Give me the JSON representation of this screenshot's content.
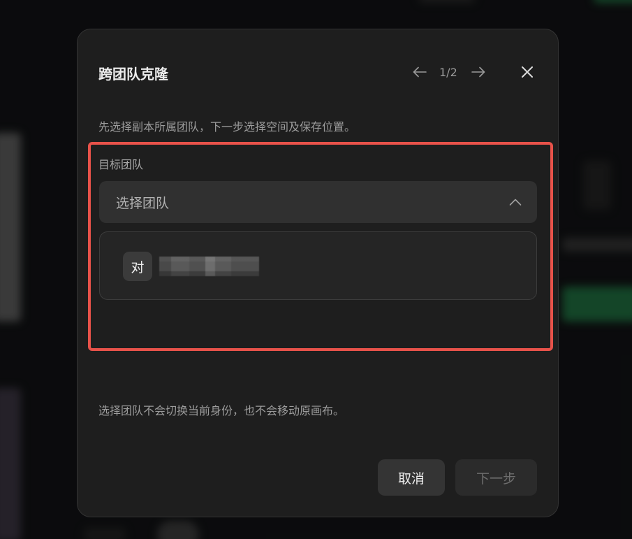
{
  "dialog": {
    "title": "跨团队克隆",
    "pagination": "1/2",
    "description": "先选择副本所属团队，下一步选择空间及保存位置。",
    "field_label": "目标团队",
    "select_placeholder": "选择团队",
    "option": {
      "avatar_text": "对"
    },
    "note": "选择团队不会切换当前身份，也不会移动原画布。",
    "cancel_label": "取消",
    "next_label": "下一步"
  },
  "colors": {
    "highlight": "#e8524a",
    "surface": "#1e1e1e",
    "input": "#303030"
  },
  "icons": [
    "arrow-left-icon",
    "arrow-right-icon",
    "close-icon",
    "chevron-up-icon"
  ]
}
